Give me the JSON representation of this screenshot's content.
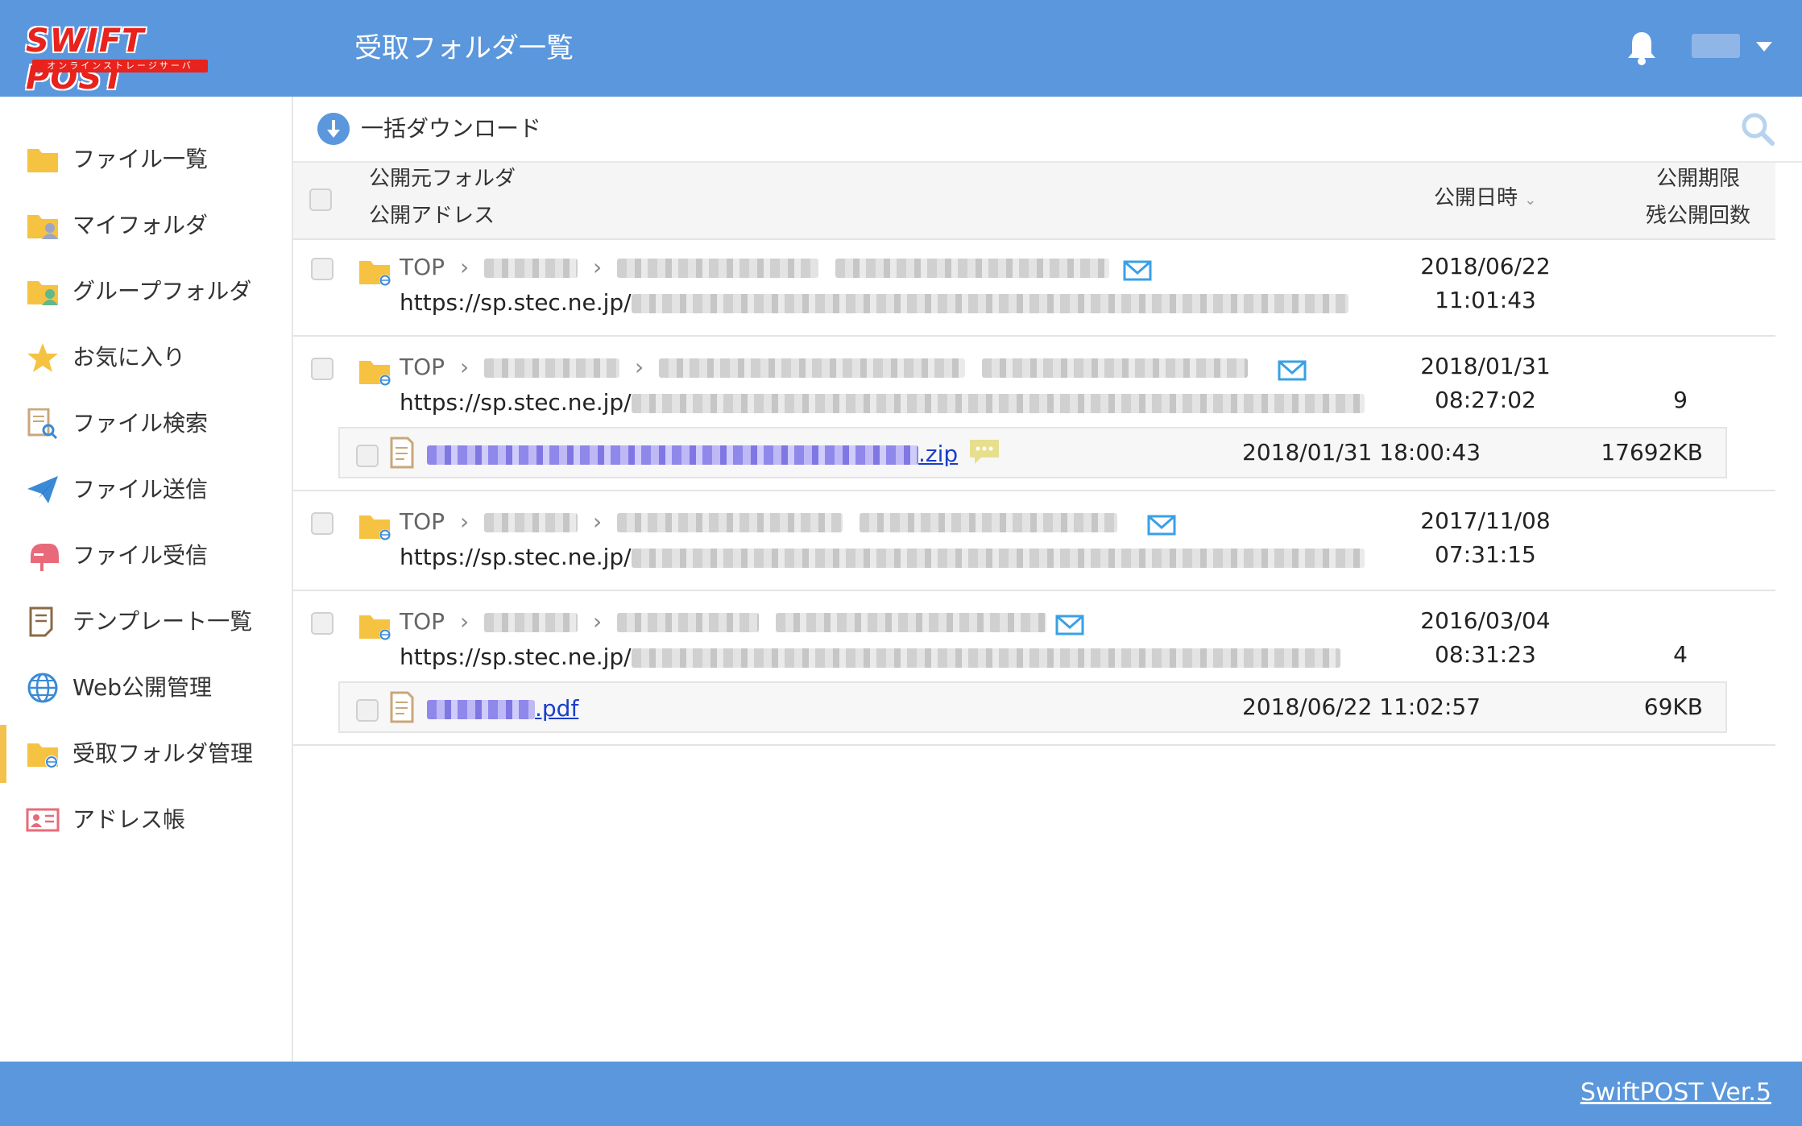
{
  "header": {
    "logo_text": "SWIFT POST",
    "logo_sub": "オンラインストレージサーバ",
    "title": "受取フォルダ一覧"
  },
  "sidebar": {
    "items": [
      {
        "label": "ファイル一覧",
        "icon": "folder-icon"
      },
      {
        "label": "マイフォルダ",
        "icon": "my-folder-icon"
      },
      {
        "label": "グループフォルダ",
        "icon": "group-folder-icon"
      },
      {
        "label": "お気に入り",
        "icon": "star-icon"
      },
      {
        "label": "ファイル検索",
        "icon": "file-search-icon"
      },
      {
        "label": "ファイル送信",
        "icon": "paper-plane-icon"
      },
      {
        "label": "ファイル受信",
        "icon": "mailbox-icon"
      },
      {
        "label": "テンプレート一覧",
        "icon": "template-icon"
      },
      {
        "label": "Web公開管理",
        "icon": "globe-icon"
      },
      {
        "label": "受取フォルダ管理",
        "icon": "receive-folder-icon",
        "active": true
      },
      {
        "label": "アドレス帳",
        "icon": "address-book-icon"
      }
    ]
  },
  "toolbar": {
    "download_label": "一括ダウンロード"
  },
  "table": {
    "col_source_folder": "公開元フォルダ",
    "col_public_address": "公開アドレス",
    "col_published_at": "公開日時",
    "col_sort_caret": "⌄",
    "col_expiry": "公開期限",
    "col_remaining": "残公開回数",
    "rows": [
      {
        "crumb_root": "TOP",
        "url_prefix": "https://sp.stec.ne.jp/",
        "date": "2018/06/22",
        "time": "11:01:43",
        "remaining": ""
      },
      {
        "crumb_root": "TOP",
        "url_prefix": "https://sp.stec.ne.jp/",
        "date": "2018/01/31",
        "time": "08:27:02",
        "remaining": "9",
        "file": {
          "ext": ".zip",
          "datetime": "2018/01/31 18:00:43",
          "size": "17692KB",
          "has_comment": true
        }
      },
      {
        "crumb_root": "TOP",
        "url_prefix": "https://sp.stec.ne.jp/",
        "date": "2017/11/08",
        "time": "07:31:15",
        "remaining": ""
      },
      {
        "crumb_root": "TOP",
        "url_prefix": "https://sp.stec.ne.jp/",
        "date": "2016/03/04",
        "time": "08:31:23",
        "remaining": "4",
        "file": {
          "ext": ".pdf",
          "datetime": "2018/06/22 11:02:57",
          "size": "69KB",
          "has_comment": false
        }
      }
    ]
  },
  "footer": {
    "version": "SwiftPOST Ver.5"
  },
  "colors": {
    "header_bg": "#5b97dc",
    "active_marker": "#f2c14e",
    "link": "#1a3ec8",
    "mail_icon": "#3aa0e6"
  }
}
